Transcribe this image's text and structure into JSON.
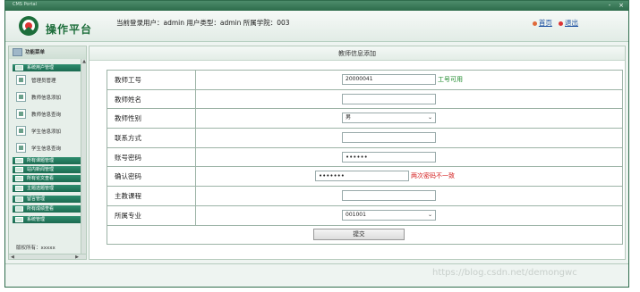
{
  "window": {
    "title": "CMS Portal",
    "close_glyph": "×",
    "min_glyph": "-"
  },
  "header": {
    "logo_text": "操作平台",
    "login_info": "当前登录用户：admin  用户类型：admin  所属学院：003",
    "links": {
      "home": "首页",
      "logout": "退出"
    }
  },
  "sidebar": {
    "title": "功能菜单",
    "groups": [
      {
        "label": "系统用户管理"
      },
      {
        "label": "所有课题管理"
      },
      {
        "label": "站内新闻管理"
      },
      {
        "label": "所有论文查看"
      },
      {
        "label": "主题选题管理"
      },
      {
        "label": "留言管理"
      },
      {
        "label": "所有成绩查看"
      },
      {
        "label": "系统管理"
      }
    ],
    "items": [
      {
        "label": "管理员管理"
      },
      {
        "label": "教师信息添加"
      },
      {
        "label": "教师信息查询"
      },
      {
        "label": "学生信息添加"
      },
      {
        "label": "学生信息查询"
      }
    ],
    "copyright": "版权所有：xxxxx"
  },
  "content": {
    "title": "教师信息添加",
    "form": {
      "teacher_id": {
        "label": "教师工号",
        "value": "20000041",
        "hint": "工号可用"
      },
      "teacher_name": {
        "label": "教师姓名",
        "value": ""
      },
      "gender": {
        "label": "教师性别",
        "value": "男"
      },
      "contact": {
        "label": "联系方式",
        "value": ""
      },
      "password": {
        "label": "账号密码",
        "value": "••••••"
      },
      "confirm_password": {
        "label": "确认密码",
        "value": "•••••••",
        "hint": "两次密码不一致"
      },
      "course": {
        "label": "主教课程",
        "value": ""
      },
      "major": {
        "label": "所属专业",
        "value": "001001"
      },
      "submit_label": "提交"
    }
  },
  "watermark": "https://blog.csdn.net/demongwc",
  "colors": {
    "brand": "#1d6e3b",
    "ok": "#1d8a2b",
    "error": "#d42020",
    "link": "#1a4fa0"
  }
}
